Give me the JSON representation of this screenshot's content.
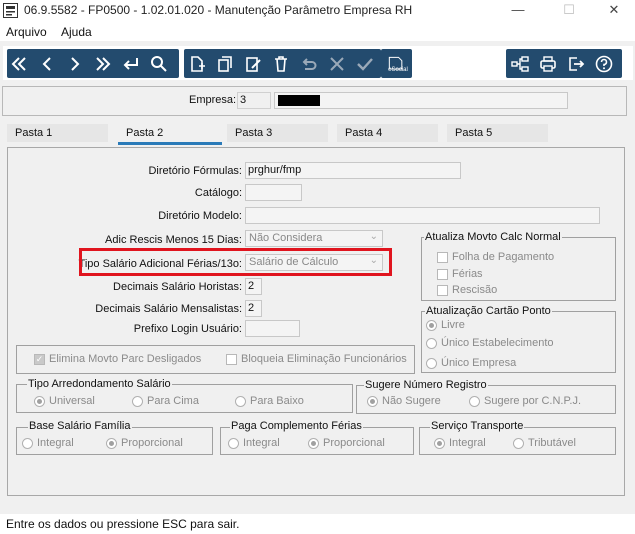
{
  "window": {
    "title": "06.9.5582 - FP0500 - 1.02.01.020 - Manutenção Parâmetro Empresa RH",
    "minimize": "—",
    "maximize": "☐",
    "close": "✕"
  },
  "menu": {
    "items": [
      "Arquivo",
      "Ajuda"
    ]
  },
  "toolbar": {
    "icons": [
      "first-icon",
      "previous-icon",
      "next-icon",
      "last-icon",
      "return-icon",
      "search-icon",
      "new-document-icon",
      "copy-icon",
      "edit-icon",
      "delete-icon",
      "undo-icon",
      "cancel-icon",
      "confirm-icon",
      "esocial-icon",
      "hierarchy-icon",
      "print-icon",
      "exit-icon",
      "help-icon"
    ],
    "esocial_label": "eSocial"
  },
  "empresa": {
    "label": "Empresa:",
    "code": "3",
    "name": ""
  },
  "tabs": [
    "Pasta 1",
    "Pasta 2",
    "Pasta 3",
    "Pasta 4",
    "Pasta 5"
  ],
  "active_tab": "Pasta 2",
  "fields": {
    "diretorio_formulas": {
      "label": "Diretório Fórmulas:",
      "value": "prghur/fmp"
    },
    "catalogo": {
      "label": "Catálogo:",
      "value": ""
    },
    "diretorio_modelo": {
      "label": "Diretório Modelo:",
      "value": ""
    },
    "adic_rescis": {
      "label": "Adic Rescis Menos 15 Dias:",
      "value": "Não Considera"
    },
    "tipo_salario_adicional": {
      "label": "Tipo Salário Adicional Férias/13o:",
      "value": "Salário de Cálculo"
    },
    "decimais_horistas": {
      "label": "Decimais Salário Horistas:",
      "value": "2"
    },
    "decimais_mensalistas": {
      "label": "Decimais Salário Mensalistas:",
      "value": "2"
    },
    "prefixo_login": {
      "label": "Prefixo Login Usuário:",
      "value": ""
    }
  },
  "checks": {
    "elimina_movto": {
      "label": "Elimina Movto Parc Desligados",
      "checked": true
    },
    "bloqueia_eliminacao": {
      "label": "Bloqueia Eliminação Funcionários",
      "checked": false
    }
  },
  "groups": {
    "atualiza_movto": {
      "title": "Atualiza Movto Calc Normal",
      "options": [
        {
          "label": "Folha de Pagamento",
          "checked": false
        },
        {
          "label": "Férias",
          "checked": false
        },
        {
          "label": "Rescisão",
          "checked": false
        }
      ]
    },
    "atualizacao_cartao": {
      "title": "Atualização Cartão Ponto",
      "options": [
        {
          "label": "Livre",
          "selected": true
        },
        {
          "label": "Único Estabelecimento",
          "selected": false
        },
        {
          "label": "Único Empresa",
          "selected": false
        }
      ]
    },
    "tipo_arredondamento": {
      "title": "Tipo Arredondamento Salário",
      "options": [
        {
          "label": "Universal",
          "selected": true
        },
        {
          "label": "Para Cima",
          "selected": false
        },
        {
          "label": "Para Baixo",
          "selected": false
        }
      ]
    },
    "sugere_numero": {
      "title": "Sugere Número Registro",
      "options": [
        {
          "label": "Não Sugere",
          "selected": true
        },
        {
          "label": "Sugere por C.N.P.J.",
          "selected": false
        }
      ]
    },
    "base_salario": {
      "title": "Base Salário Família",
      "options": [
        {
          "label": "Integral",
          "selected": false
        },
        {
          "label": "Proporcional",
          "selected": true
        }
      ]
    },
    "paga_complemento": {
      "title": "Paga Complemento Férias",
      "options": [
        {
          "label": "Integral",
          "selected": false
        },
        {
          "label": "Proporcional",
          "selected": true
        }
      ]
    },
    "servico_transporte": {
      "title": "Serviço Transporte",
      "options": [
        {
          "label": "Integral",
          "selected": true
        },
        {
          "label": "Tributável",
          "selected": false
        }
      ]
    }
  },
  "status": "Entre os dados ou pressione ESC para sair."
}
